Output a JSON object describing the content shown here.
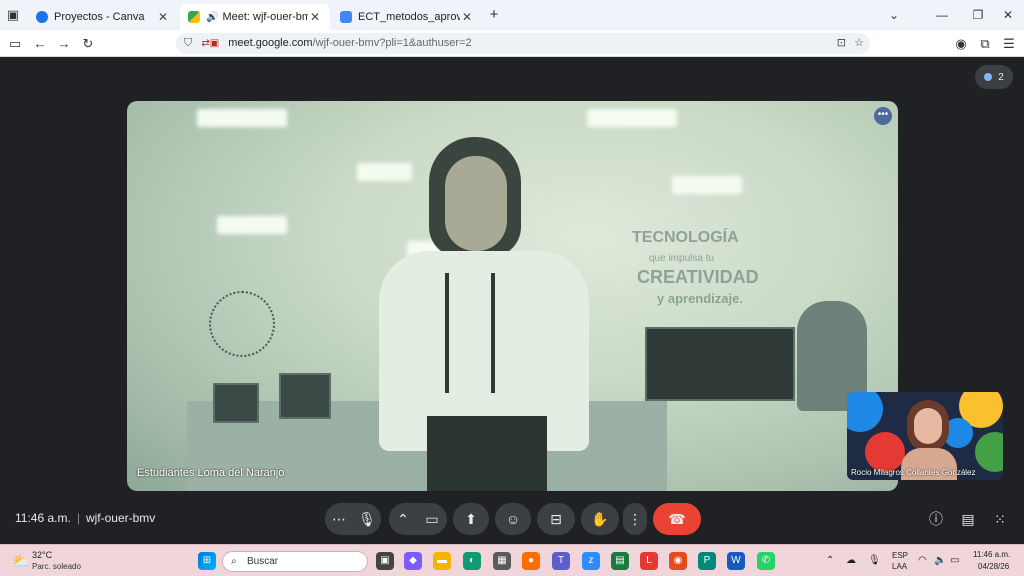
{
  "browser": {
    "tabs": [
      {
        "title": "Proyectos - Canva",
        "active": false,
        "favicon_color": "#1a73e8"
      },
      {
        "title": "Meet: wjf-ouer-bmv",
        "active": true,
        "favicon_color": "#34a853"
      },
      {
        "title": "ECT_metodos_aprovechar_meta",
        "active": false,
        "favicon_color": "#4285f4"
      }
    ],
    "new_tab": "+",
    "url_host": "meet.google.com",
    "url_rest": "/wjf-ouer-bmv?pli=1&authuser=2"
  },
  "meet": {
    "main_video_label": "Estudiantes Loma del Naranjo",
    "wall_sign": {
      "line1": "TECNOLOGÍA",
      "line2": "que impulsa tu",
      "line3": "CREATIVIDAD",
      "line4": "y aprendizaje."
    },
    "self_view_label": "Rocio Milagros Collantes González",
    "participant_count": "2",
    "time": "11:46 a.m.",
    "meeting_code": "wjf-ouer-bmv",
    "colors": {
      "background": "#202124",
      "control": "#3c4043",
      "end_call": "#ea4335"
    }
  },
  "taskbar": {
    "weather_temp": "32°C",
    "weather_desc": "Parc. soleado",
    "search_placeholder": "Buscar",
    "lang_line1": "ESP",
    "lang_line2": "LAA",
    "time": "11:46 a.m.",
    "date": "04/28/26"
  }
}
